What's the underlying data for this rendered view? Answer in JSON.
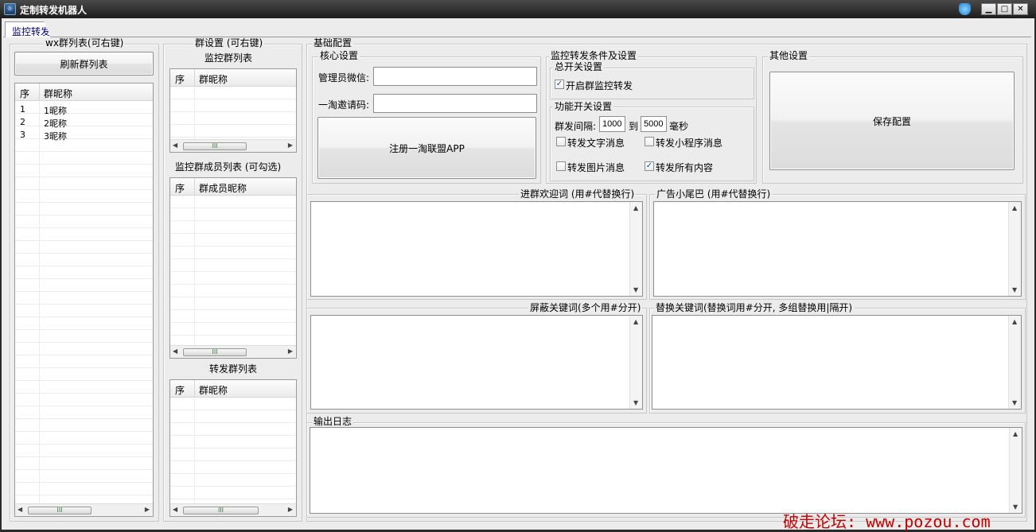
{
  "window": {
    "title": "定制转发机器人",
    "controls": {
      "minimize": "▁",
      "maximize": "□",
      "close": "✕"
    }
  },
  "tabs": [
    {
      "label": "监控转发",
      "active": true
    }
  ],
  "wx_group_panel": {
    "title": "wx群列表(可右键)",
    "refresh_button": "刷新群列表",
    "columns": [
      "序",
      "群昵称"
    ],
    "rows": [
      {
        "index": "1",
        "name": "1昵称"
      },
      {
        "index": "2",
        "name": "2昵称"
      },
      {
        "index": "3",
        "name": "3昵称"
      }
    ],
    "scroll_thumb": "III"
  },
  "group_settings": {
    "title": "群设置 (可右键)",
    "monitor_list": {
      "title": "监控群列表",
      "columns": [
        "序",
        "群昵称"
      ],
      "scroll_thumb": "III"
    },
    "member_list": {
      "title": "监控群成员列表 (可勾选)",
      "columns": [
        "序",
        "群成员昵称"
      ],
      "scroll_thumb": "III"
    },
    "forward_list": {
      "title": "转发群列表",
      "columns": [
        "序",
        "群昵称"
      ],
      "scroll_thumb": "III"
    }
  },
  "basic_config": {
    "title": "基础配置",
    "core": {
      "title": "核心设置",
      "admin_label": "管理员微信:",
      "admin_value": "",
      "invite_label": "一淘邀请码:",
      "invite_value": "",
      "register_button": "注册一淘联盟APP"
    },
    "monitor": {
      "title": "监控转发条件及设置",
      "master_switch": {
        "title": "总开关设置",
        "enable_label": "开启群监控转发",
        "enable_checked": true
      },
      "feature_switch": {
        "title": "功能开关设置",
        "interval_label": "群发间隔:",
        "interval_min": "1000",
        "to_label": "到",
        "interval_max": "5000",
        "unit_label": "毫秒",
        "forward_text": {
          "label": "转发文字消息",
          "checked": false
        },
        "forward_miniprogram": {
          "label": "转发小程序消息",
          "checked": false
        },
        "forward_image": {
          "label": "转发图片消息",
          "checked": false
        },
        "forward_all": {
          "label": "转发所有内容",
          "checked": true
        }
      }
    },
    "other": {
      "title": "其他设置",
      "save_button": "保存配置"
    }
  },
  "text_areas": {
    "welcome": "进群欢迎词 (用#代替换行)",
    "ad_tail": "广告小尾巴 (用#代替换行)",
    "block_keywords": "屏蔽关键词(多个用#分开)",
    "replace_keywords": "替换关键词(替换词用#分开, 多组替换用|隔开)",
    "log": "输出日志"
  },
  "watermark": "破走论坛: www.pozou.com",
  "icons": {
    "checkmark": "✓",
    "scroll_up": "▲",
    "scroll_down": "▼",
    "scroll_left": "◀",
    "scroll_right": "▶",
    "app": "☼"
  }
}
